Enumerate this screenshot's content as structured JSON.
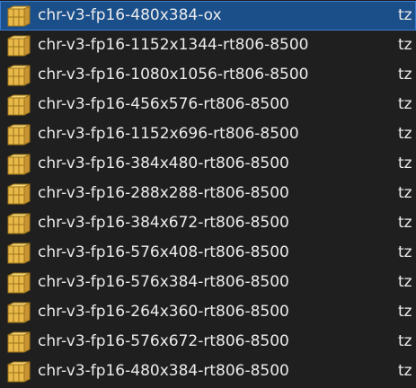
{
  "files": [
    {
      "name": "chr-v3-fp16-480x384-ox",
      "type": "tz",
      "icon": "archive-icon",
      "selected": true
    },
    {
      "name": "chr-v3-fp16-1152x1344-rt806-8500",
      "type": "tz",
      "icon": "archive-icon",
      "selected": false
    },
    {
      "name": "chr-v3-fp16-1080x1056-rt806-8500",
      "type": "tz",
      "icon": "archive-icon",
      "selected": false
    },
    {
      "name": "chr-v3-fp16-456x576-rt806-8500",
      "type": "tz",
      "icon": "archive-icon",
      "selected": false
    },
    {
      "name": "chr-v3-fp16-1152x696-rt806-8500",
      "type": "tz",
      "icon": "archive-icon",
      "selected": false
    },
    {
      "name": "chr-v3-fp16-384x480-rt806-8500",
      "type": "tz",
      "icon": "archive-icon",
      "selected": false
    },
    {
      "name": "chr-v3-fp16-288x288-rt806-8500",
      "type": "tz",
      "icon": "archive-icon",
      "selected": false
    },
    {
      "name": "chr-v3-fp16-384x672-rt806-8500",
      "type": "tz",
      "icon": "archive-icon",
      "selected": false
    },
    {
      "name": "chr-v3-fp16-576x408-rt806-8500",
      "type": "tz",
      "icon": "archive-icon",
      "selected": false
    },
    {
      "name": "chr-v3-fp16-576x384-rt806-8500",
      "type": "tz",
      "icon": "archive-icon",
      "selected": false
    },
    {
      "name": "chr-v3-fp16-264x360-rt806-8500",
      "type": "tz",
      "icon": "archive-icon",
      "selected": false
    },
    {
      "name": "chr-v3-fp16-576x672-rt806-8500",
      "type": "tz",
      "icon": "archive-icon",
      "selected": false
    },
    {
      "name": "chr-v3-fp16-480x384-rt806-8500",
      "type": "tz",
      "icon": "archive-icon",
      "selected": false
    }
  ],
  "colors": {
    "background": "#1f1f1f",
    "selection": "#1b4f8a",
    "text": "#ececec",
    "archive_icon": "#e8b84a"
  }
}
